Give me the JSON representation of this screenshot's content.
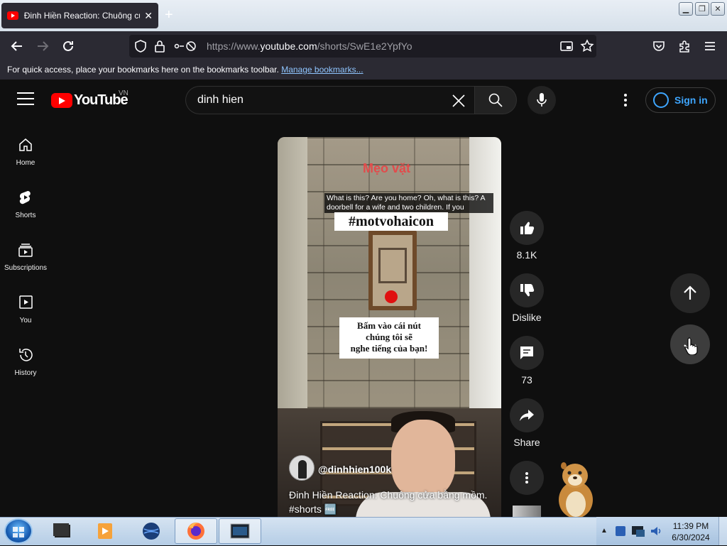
{
  "browser": {
    "tab_title": "Đinh Hiền Reaction: Chuông cửa",
    "tab_close": "✕",
    "new_tab": "+",
    "url_prefix": "https://www.",
    "url_host": "youtube.com",
    "url_path": "/shorts/SwE1e2YpfYo",
    "bookmarks_message": "For quick access, place your bookmarks here on the bookmarks toolbar.",
    "bookmarks_link": "Manage bookmarks..."
  },
  "youtube": {
    "logo_text": "YouTube",
    "country_code": "VN",
    "search_value": "dinh hien",
    "signin_label": "Sign in",
    "sidebar": [
      {
        "id": "home",
        "label": "Home"
      },
      {
        "id": "shorts",
        "label": "Shorts"
      },
      {
        "id": "subscriptions",
        "label": "Subscriptions"
      },
      {
        "id": "you",
        "label": "You"
      },
      {
        "id": "history",
        "label": "History"
      }
    ],
    "video": {
      "overlay_title": "Mẹo vặt",
      "caption": "What is this? Are you home? Oh, what is this? A doorbell for a wife and two children. If you",
      "hashtag_sign": "#motvohaicon",
      "notice_line1": "Bấm vào cái nút",
      "notice_line2": "chúng tôi sẽ",
      "notice_line3": "nghe tiếng của bạn!",
      "channel": "@dinhhien100k",
      "title_line1": "Đinh Hiền Reaction: Chuông cửa bằng mồm.",
      "title_line2": "#shorts 🆓"
    },
    "actions": {
      "likes": "8.1K",
      "dislike_label": "Dislike",
      "comments": "73",
      "share_label": "Share"
    }
  },
  "taskbar": {
    "time": "11:39 PM",
    "date": "6/30/2024"
  },
  "colors": {
    "yt_red": "#ff0000",
    "yt_bg": "#0f0f0f",
    "link_blue": "#3ea6ff"
  }
}
